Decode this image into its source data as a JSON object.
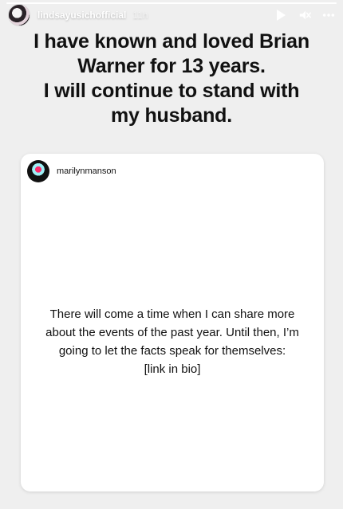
{
  "story": {
    "username": "lindsayusichofficial",
    "time": "11h",
    "progress": 1.0,
    "icons": {
      "avatar": "profile-photo",
      "play": "play-icon",
      "mute": "mute-icon",
      "more": "more-icon"
    }
  },
  "headline": {
    "lines": [
      "I have known and loved Brian",
      "Warner for 13 years.",
      "I will continue to stand with",
      "my husband."
    ]
  },
  "post": {
    "username": "marilynmanson",
    "text_lines": [
      "There will come a time when I can share more",
      "about the events of the past year. Until then, I’m",
      "going to let the facts speak for themselves:",
      "[link in bio]"
    ]
  }
}
